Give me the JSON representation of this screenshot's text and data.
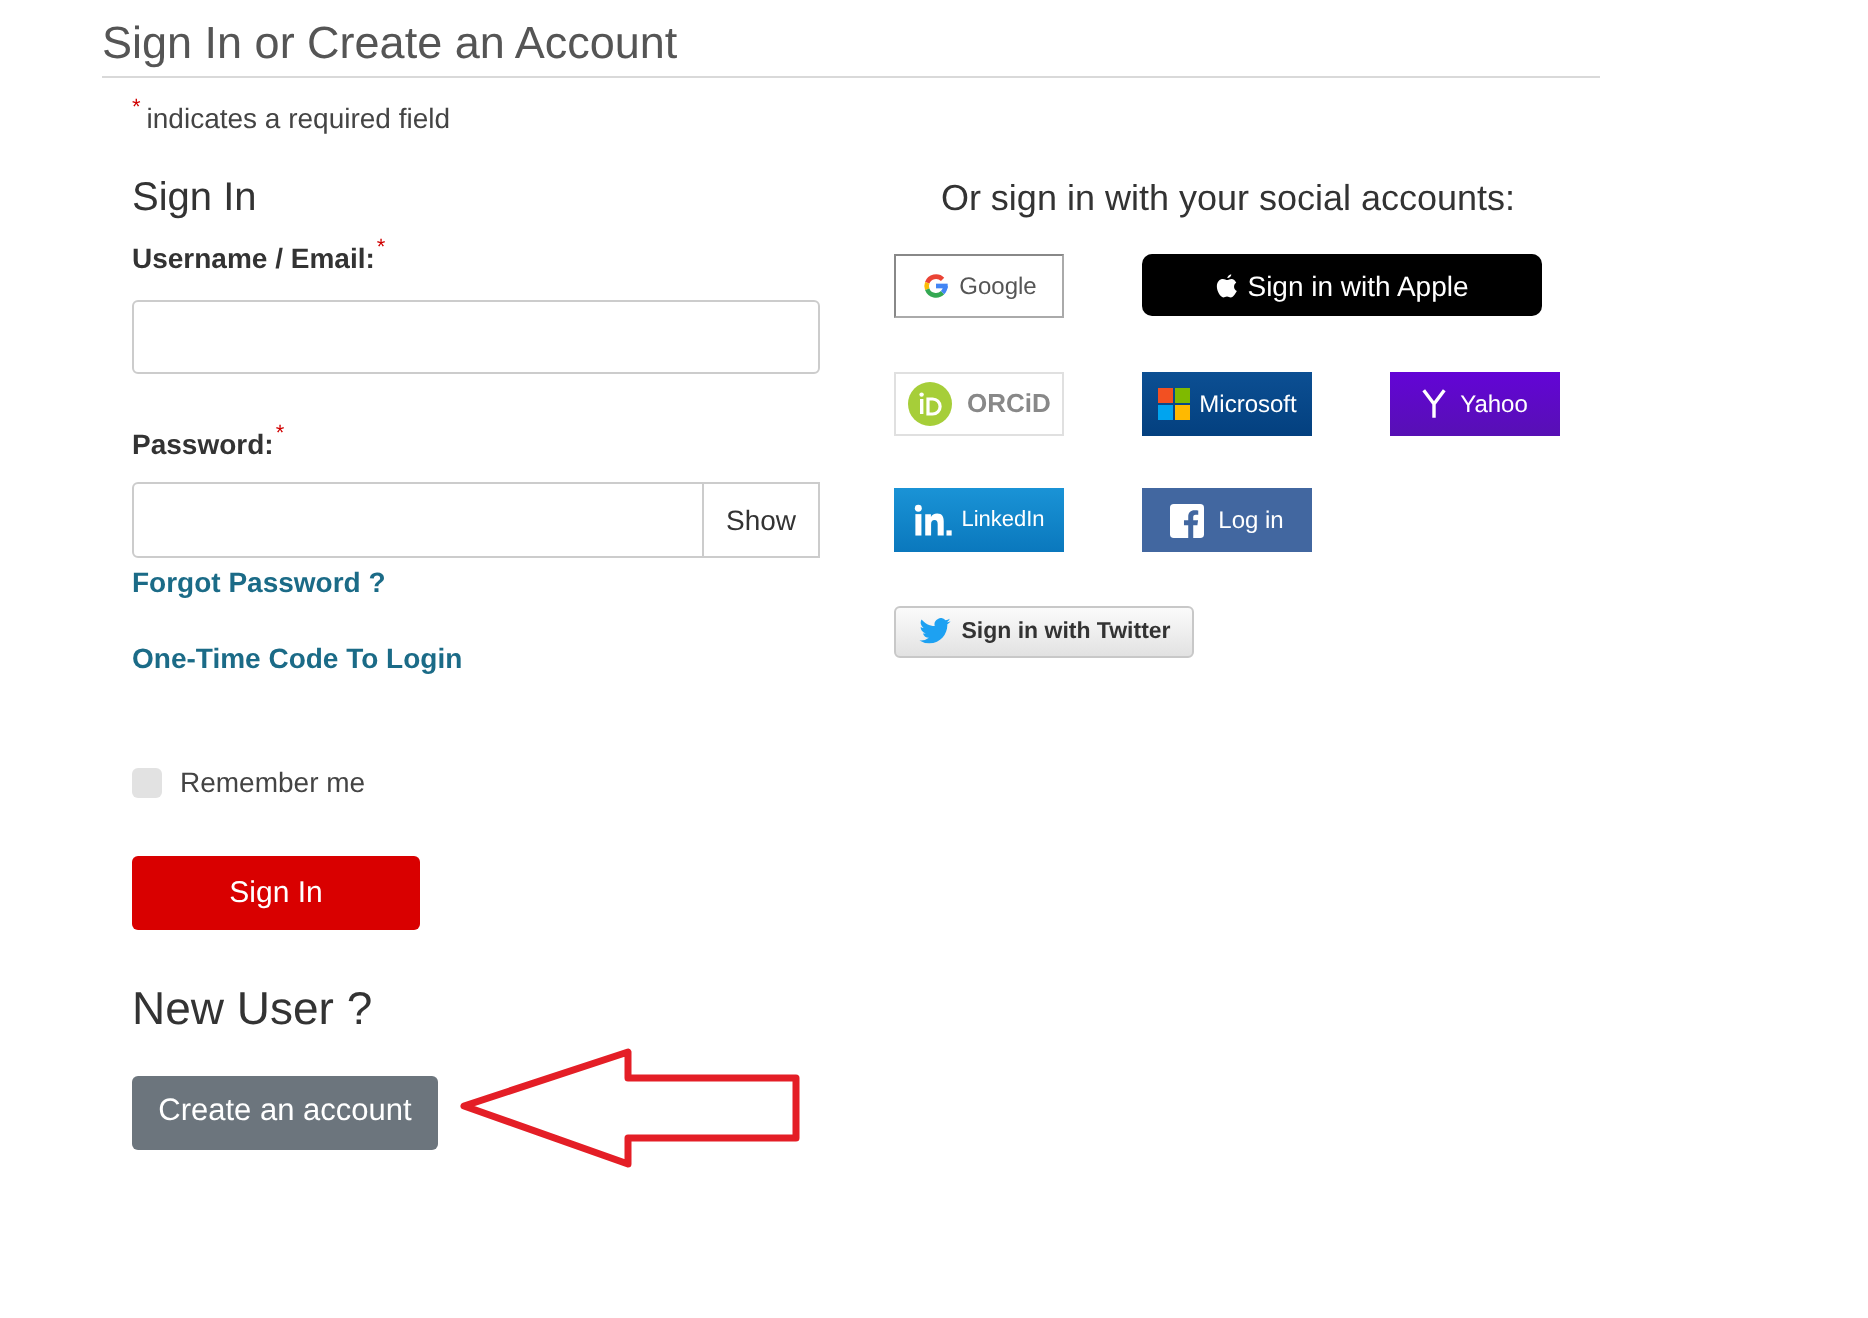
{
  "page": {
    "title": "Sign In or Create an Account",
    "required_note": {
      "mark": "*",
      "text": "indicates a required field"
    }
  },
  "sign_in": {
    "heading": "Sign In",
    "fields": [
      {
        "kind": "text",
        "label": "Username / Email:",
        "required_mark": "*"
      },
      {
        "kind": "password",
        "label": "Password:",
        "required_mark": "*",
        "toggle": "Show"
      }
    ],
    "forgot_link": "Forgot Password ?",
    "code_link": "One-Time Code To Login",
    "remember_me": {
      "label": "Remember me",
      "checked": false
    },
    "submit": "Sign In"
  },
  "new_user": {
    "heading": "New User ?",
    "button": {
      "label": "Create an account",
      "highlighted": true
    }
  },
  "social": {
    "heading": "Or sign in with your social accounts:",
    "rows": [
      {
        "providers": [
          {
            "kind": "google",
            "label": "Google"
          },
          {
            "kind": "apple",
            "label": "Sign in with Apple"
          }
        ]
      },
      {
        "providers": [
          {
            "kind": "orcid",
            "label": "ORCiD"
          },
          {
            "kind": "microsoft",
            "label": "Microsoft"
          },
          {
            "kind": "yahoo",
            "label": "Yahoo"
          }
        ]
      },
      {
        "providers": [
          {
            "kind": "linkedin",
            "label": "LinkedIn"
          },
          {
            "kind": "facebook",
            "label": "Log in"
          }
        ]
      },
      {
        "providers": [
          {
            "kind": "twitter",
            "label": "Sign in with Twitter"
          }
        ]
      }
    ]
  }
}
